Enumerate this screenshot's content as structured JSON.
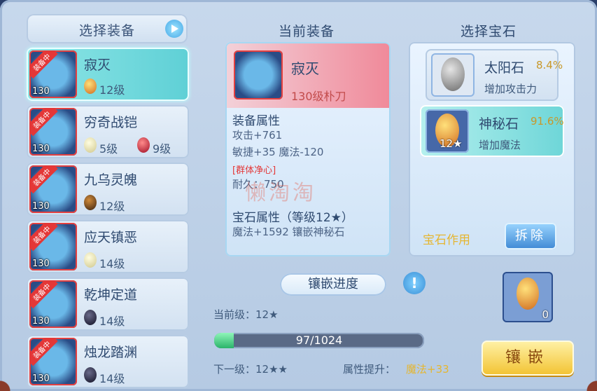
{
  "left_panel": {
    "title": "选择装备",
    "items": [
      {
        "name": "寂灭",
        "level": "130",
        "badge": "装备中",
        "gems": [
          {
            "type": "myst",
            "text": "12级"
          }
        ],
        "selected": true
      },
      {
        "name": "穷奇战铠",
        "level": "130",
        "badge": "装备中",
        "gems": [
          {
            "type": "sun",
            "text": "5级"
          },
          {
            "type": "red",
            "text": "9级"
          }
        ]
      },
      {
        "name": "九乌灵魄",
        "level": "130",
        "badge": "装备中",
        "gems": [
          {
            "type": "brown",
            "text": "12级"
          }
        ]
      },
      {
        "name": "应天镇恶",
        "level": "130",
        "badge": "装备中",
        "gems": [
          {
            "type": "sun",
            "text": "14级"
          }
        ]
      },
      {
        "name": "乾坤定道",
        "level": "130",
        "badge": "装备中",
        "gems": [
          {
            "type": "dark",
            "text": "14级"
          }
        ]
      },
      {
        "name": "烛龙踏渊",
        "level": "130",
        "badge": "装备中",
        "gems": [
          {
            "type": "dark",
            "text": "14级"
          }
        ]
      }
    ]
  },
  "center_panel": {
    "title": "当前装备",
    "equip_name": "寂灭",
    "equip_type": "130级朴刀",
    "attr_header": "装备属性",
    "attrs": [
      "攻击+761",
      "敏捷+35 魔法-120"
    ],
    "special": "[群体净心]",
    "durability": "耐久：750",
    "gem_attr_header": "宝石属性（等级12★）",
    "gem_attr_line": "魔法+1592 镶嵌神秘石"
  },
  "right_panel": {
    "title": "选择宝石",
    "gems": [
      {
        "name": "太阳石",
        "pct": "8.4%",
        "desc": "增加攻击力",
        "level": ""
      },
      {
        "name": "神秘石",
        "pct": "91.6%",
        "desc": "增加魔法",
        "level": "12★"
      }
    ],
    "effect_label": "宝石作用",
    "remove_label": "拆除"
  },
  "bottom": {
    "progress_title": "镶嵌进度",
    "info_icon": "!",
    "current_level": "当前级：12★",
    "progress_text": "97/1024",
    "progress_fraction": 0.0947,
    "next_level": "下一级：12★★",
    "attr_boost_label": "属性提升：",
    "attr_boost_value": "魔法+33",
    "slot_count": "0",
    "inlay_label": "镶嵌"
  },
  "watermark": "懒淘淘"
}
